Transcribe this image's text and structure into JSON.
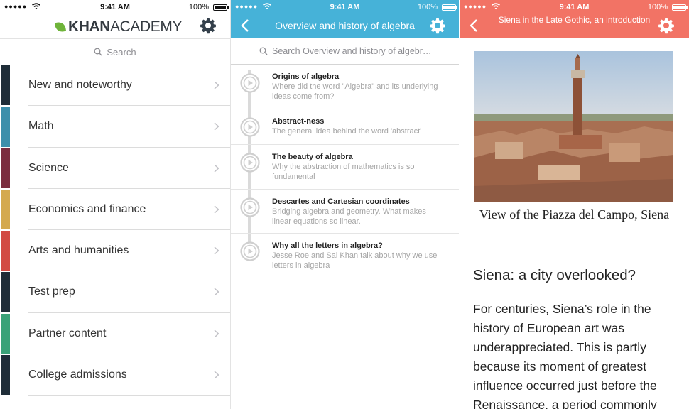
{
  "status_bar": {
    "signal": "●●●●●",
    "time": "9:41 AM",
    "battery": "100%"
  },
  "home": {
    "logo_prefix": "KHAN",
    "logo_suffix": "ACADEMY",
    "search_placeholder": "Search",
    "domains": [
      {
        "label": "New and noteworthy",
        "color": "#1f2d38"
      },
      {
        "label": "Math",
        "color": "#3d8fab"
      },
      {
        "label": "Science",
        "color": "#7b2d3f"
      },
      {
        "label": "Economics and finance",
        "color": "#d4a94f"
      },
      {
        "label": "Arts and humanities",
        "color": "#d24b44"
      },
      {
        "label": "Test prep",
        "color": "#1f2d38"
      },
      {
        "label": "Partner content",
        "color": "#3aa278"
      },
      {
        "label": "College admissions",
        "color": "#1f2d38"
      }
    ]
  },
  "topic": {
    "title": "Overview and history of algebra",
    "color": "#46b2d8",
    "search_placeholder": "Search Overview and history of algebr…",
    "videos": [
      {
        "title": "Origins of algebra",
        "description": "Where did the word \"Algebra\" and its underlying ideas come from?"
      },
      {
        "title": "Abstract-ness",
        "description": "The general idea behind the word 'abstract'"
      },
      {
        "title": "The beauty of algebra",
        "description": "Why the abstraction of mathematics is so fundamental"
      },
      {
        "title": "Descartes and Cartesian coordinates",
        "description": "Bridging algebra and geometry.  What makes linear equations so linear."
      },
      {
        "title": "Why all the letters in algebra?",
        "description": "Jesse Roe and Sal Khan talk about why we use letters in algebra"
      }
    ]
  },
  "article": {
    "title": "Siena in the Late Gothic, an introduction",
    "color": "#f27365",
    "image_caption": "View of the Piazza del Campo, Siena",
    "heading": "Siena: a city overlooked?",
    "body": "For centuries, Siena’s role in the history of European art was underappreciated. This is partly because its moment of greatest influence occurred just before the Renaissance, a period commonly"
  },
  "icons": {
    "settings": "gear-icon",
    "back": "chevron-left-icon",
    "search": "search-icon",
    "disclosure": "chevron-right-icon",
    "play": "play-icon"
  }
}
